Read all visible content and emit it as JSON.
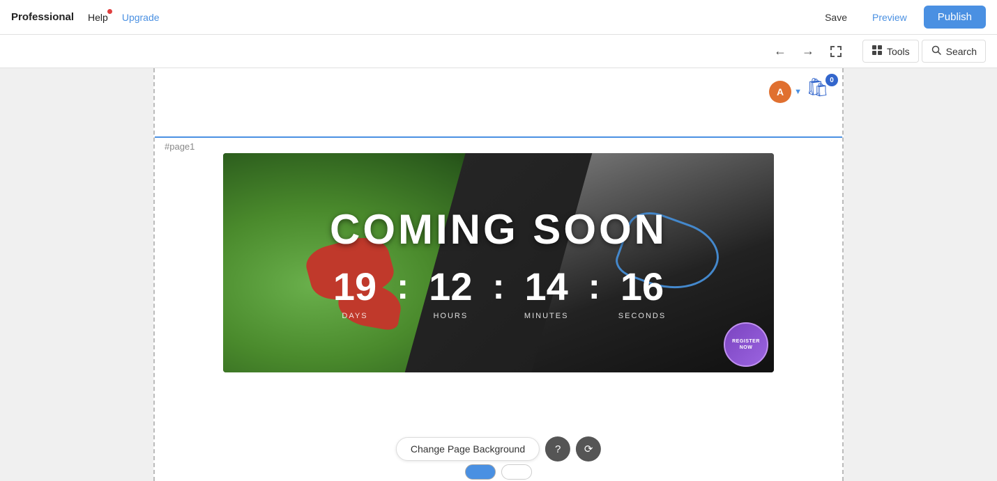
{
  "header": {
    "brand": "Professional",
    "help": "Help",
    "upgrade": "Upgrade",
    "save": "Save",
    "preview": "Preview",
    "publish": "Publish"
  },
  "toolbar": {
    "tools_label": "Tools",
    "search_label": "Search"
  },
  "canvas": {
    "page_label": "#page1"
  },
  "countdown": {
    "title": "COMING SOON",
    "days_value": "19",
    "days_label": "DAYS",
    "hours_value": "12",
    "hours_label": "HOURS",
    "minutes_value": "14",
    "minutes_label": "MINUTES",
    "seconds_value": "16",
    "seconds_label": "SECONDS",
    "colon": ":"
  },
  "cart": {
    "count": "0"
  },
  "avatar": {
    "initial": "A"
  },
  "change_bg": {
    "label": "Change Page Background"
  },
  "register_badge": {
    "text": "REGISTER NOW"
  }
}
